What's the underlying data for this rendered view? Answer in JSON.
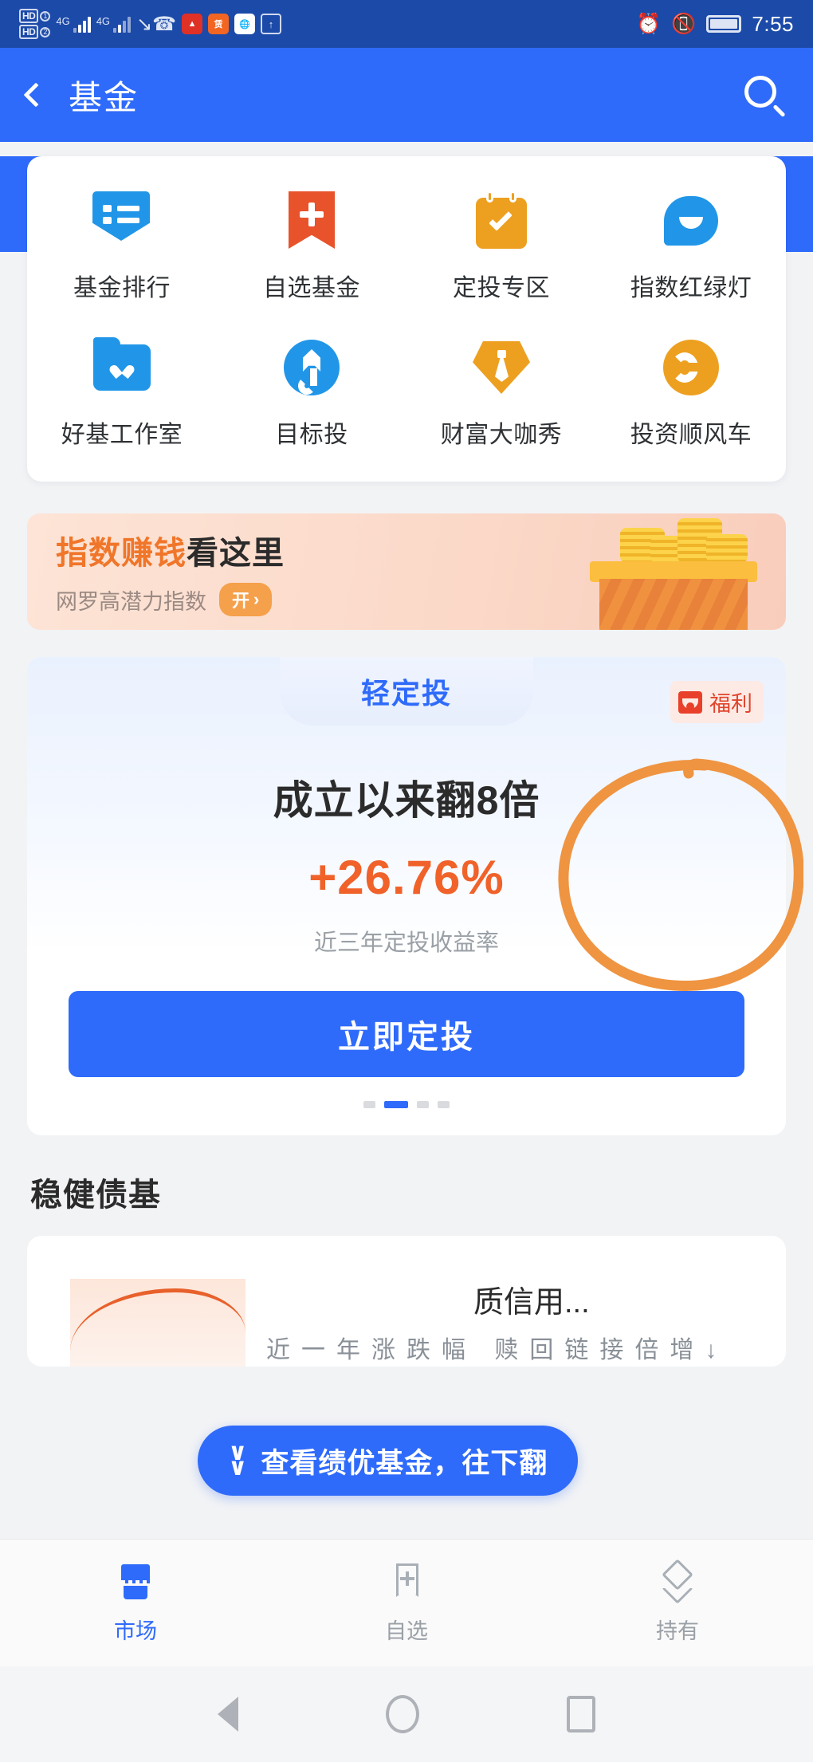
{
  "status_bar": {
    "hd1_label": "HD",
    "hd1_sim": "1",
    "hd2_label": "HD",
    "hd2_sim": "2",
    "network1": "4G",
    "network2": "4G",
    "time": "7:55",
    "icons": [
      "hd-dual-sim-icon",
      "signal-bars-icon",
      "missed-call-icon",
      "stock-app-icon",
      "zhuan-app-icon",
      "browser-app-icon",
      "upload-icon",
      "alarm-icon",
      "vibrate-icon",
      "battery-icon"
    ]
  },
  "header": {
    "back_icon": "back-chevron-icon",
    "title": "基金",
    "search_icon": "search-icon"
  },
  "shortcut_grid": {
    "rows": [
      [
        {
          "label": "基金排行",
          "icon": "ranking-shield-icon",
          "color": "#2196e8"
        },
        {
          "label": "自选基金",
          "icon": "bookmark-plus-icon",
          "color": "#e8532b"
        },
        {
          "label": "定投专区",
          "icon": "calendar-check-icon",
          "color": "#eda020"
        },
        {
          "label": "指数红绿灯",
          "icon": "chat-bubble-icon",
          "color": "#2196e8"
        }
      ],
      [
        {
          "label": "好基工作室",
          "icon": "folder-heart-icon",
          "color": "#2196e8"
        },
        {
          "label": "目标投",
          "icon": "target-a-icon",
          "color": "#2196e8"
        },
        {
          "label": "财富大咖秀",
          "icon": "diamond-tie-icon",
          "color": "#eda020"
        },
        {
          "label": "投资顺风车",
          "icon": "circle-arrow-icon",
          "color": "#eda020"
        }
      ]
    ]
  },
  "ad_banner": {
    "headline_highlight": "指数赚钱",
    "headline_rest": "看这里",
    "subtitle": "网罗高潜力指数",
    "cta_label": "开",
    "cta_chevron": "›",
    "illustration": "treasure-box-coins-illustration",
    "highlight_color": "#f0762a"
  },
  "promo_card": {
    "tab_label": "轻定投",
    "badge_label": "福利",
    "badge_icon": "gift-icon",
    "headline": "成立以来翻8倍",
    "percent": "+26.76%",
    "percent_color": "#f0622a",
    "caption": "近三年定投收益率",
    "cta_label": "立即定投",
    "cta_color": "#2f6bfa",
    "dots_total": 4,
    "dots_active_index": 1
  },
  "section": {
    "title": "稳健债基",
    "card": {
      "fund_name": "质信用...",
      "sub_text": "近一年涨跌幅     赎回链接倍增↓",
      "chart": "orange-trend-line"
    }
  },
  "float_pill": {
    "icon": "double-chevron-down-icon",
    "label": "查看绩优基金，往下翻"
  },
  "bottom_nav": {
    "items": [
      {
        "label": "市场",
        "icon": "storefront-icon",
        "active": true
      },
      {
        "label": "自选",
        "icon": "bookmark-plus-icon",
        "active": false
      },
      {
        "label": "持有",
        "icon": "layers-icon",
        "active": false
      }
    ],
    "active_color": "#2f6bfa",
    "inactive_color": "#9aa0a6"
  },
  "system_nav": {
    "back_icon": "system-back-icon",
    "home_icon": "system-home-icon",
    "recents_icon": "system-recents-icon"
  },
  "annotation": {
    "shape": "hand-drawn-circle",
    "color": "#ef9441",
    "target": "福利"
  }
}
